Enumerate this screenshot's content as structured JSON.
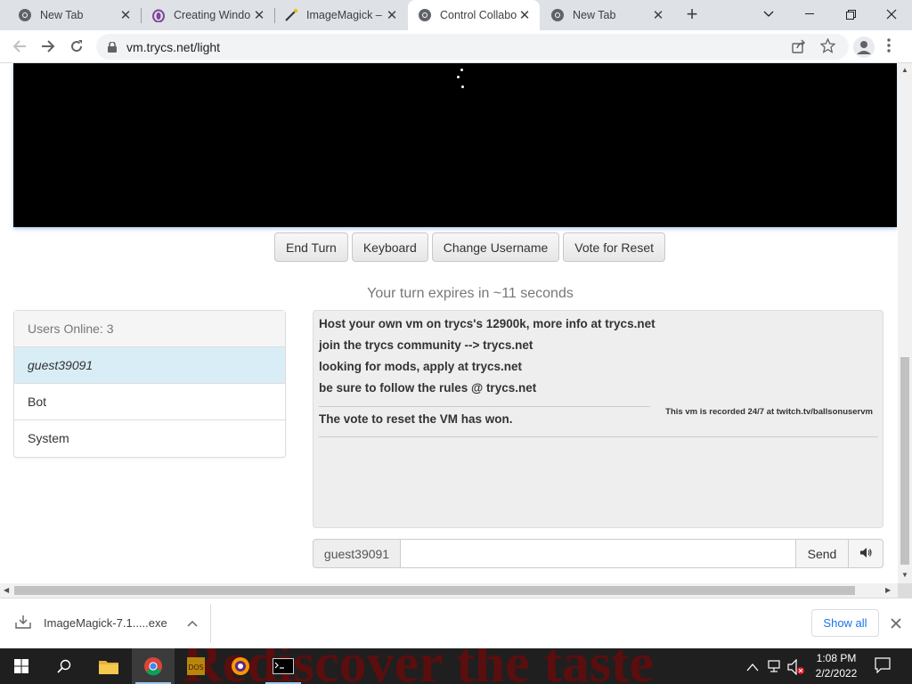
{
  "browser": {
    "tabs": [
      {
        "title": "New Tab",
        "icon": "chrome-icon"
      },
      {
        "title": "Creating Windo",
        "icon": "tor-icon"
      },
      {
        "title": "ImageMagick –",
        "icon": "imagemagick-wand-icon"
      },
      {
        "title": "Control Collabo",
        "icon": "chrome-icon",
        "active": true
      },
      {
        "title": "New Tab",
        "icon": "chrome-icon"
      }
    ],
    "url": "vm.trycs.net/light"
  },
  "vm": {
    "buttons": [
      "End Turn",
      "Keyboard",
      "Change Username",
      "Vote for Reset"
    ],
    "turn_text": "Your turn expires in ~11 seconds",
    "users_header": "Users Online: 3",
    "users": [
      "guest39091",
      "Bot",
      "System"
    ],
    "chat_messages": [
      "Host your own vm on trycs's 12900k, more info at trycs.net",
      "join the trycs community --> trycs.net",
      "looking for mods, apply at trycs.net",
      "be sure to follow the rules @ trycs.net",
      "The vote to reset the VM has won."
    ],
    "recorded_notice": "This vm is recorded 24/7 at twitch.tv/ballsonuservm",
    "username": "guest39091",
    "send_label": "Send"
  },
  "download": {
    "filename": "ImageMagick-7.1.....exe",
    "show_all": "Show all"
  },
  "taskbar": {
    "wallpaper_text": "Rediscover the taste",
    "time": "1:08 PM",
    "date": "2/2/2022"
  }
}
